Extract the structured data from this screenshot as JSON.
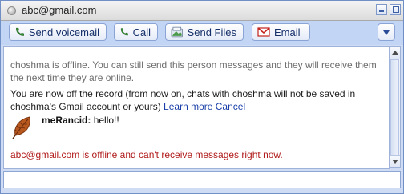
{
  "window": {
    "title": "abc@gmail.com"
  },
  "toolbar": {
    "voicemail_label": "Send voicemail",
    "call_label": "Call",
    "files_label": "Send Files",
    "email_label": "Email"
  },
  "chat": {
    "offline_notice": "choshma is offline. You can still send this person messages and they will receive them the next time they are online.",
    "record_notice": "You are now off the record (from now on, chats with choshma will not be saved in choshma's Gmail account or yours)",
    "learn_more": "Learn more",
    "cancel": "Cancel",
    "message": {
      "sender": "meRancid:",
      "text": "hello!!"
    },
    "error": "abc@gmail.com is offline and can't receive messages right now."
  },
  "input": {
    "value": ""
  },
  "colors": {
    "accent": "#1a3fa8",
    "error": "#b11b1b",
    "toolbar_bg": "#c3d5f5",
    "phone_green": "#3a8f3a",
    "email_red": "#c4221c"
  },
  "icons": [
    "status-dot-icon",
    "phone-icon",
    "phone-icon",
    "files-icon",
    "gmail-icon",
    "chevron-down-icon",
    "avatar-leaf-icon"
  ]
}
